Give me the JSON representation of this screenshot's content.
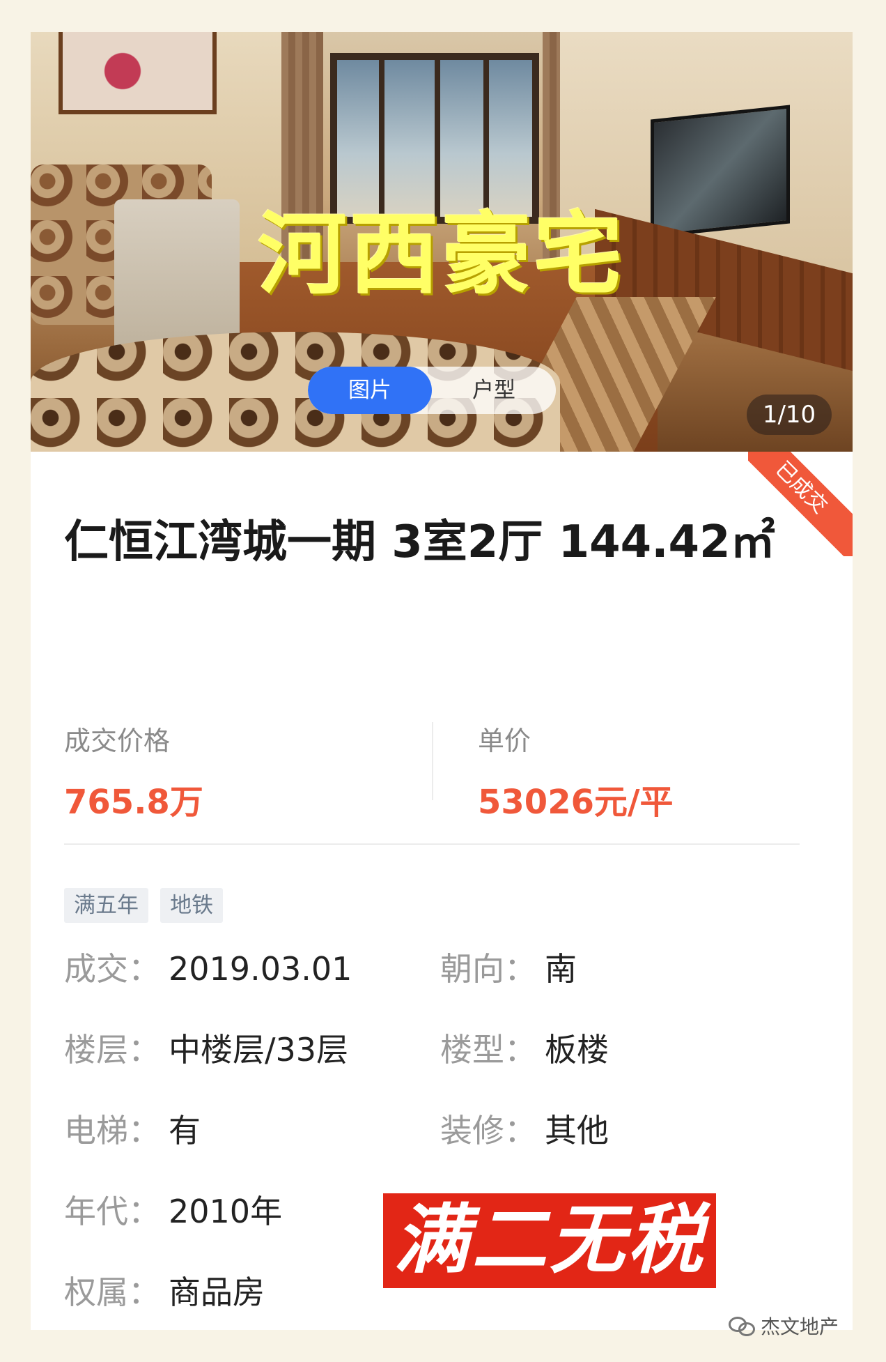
{
  "header": {
    "overlay_title": "河西豪宅",
    "tabs": [
      {
        "label": "图片",
        "active": true
      },
      {
        "label": "户型",
        "active": false
      }
    ],
    "photo_counter": "1/10"
  },
  "status_ribbon": "已成交",
  "listing": {
    "title": "仁恒江湾城一期 3室2厅 144.42㎡"
  },
  "prices": {
    "deal_label": "成交价格",
    "deal_value": "765.8万",
    "unit_label": "单价",
    "unit_value": "53026元/平"
  },
  "tags": [
    "满五年",
    "地铁"
  ],
  "details": {
    "deal_date": {
      "label": "成交：",
      "value": "2019.03.01"
    },
    "orientation": {
      "label": "朝向：",
      "value": "南"
    },
    "floor": {
      "label": "楼层：",
      "value": "中楼层/33层"
    },
    "building_type": {
      "label": "楼型：",
      "value": "板楼"
    },
    "elevator": {
      "label": "电梯：",
      "value": "有"
    },
    "decoration": {
      "label": "装修：",
      "value": "其他"
    },
    "year": {
      "label": "年代：",
      "value": "2010年"
    },
    "ownership": {
      "label": "权属：",
      "value": "商品房"
    }
  },
  "stamp_text": "满二无税",
  "watermark": {
    "icon": "wechat-icon",
    "text": "杰文地产"
  },
  "colors": {
    "accent_blue": "#3072f6",
    "price_red": "#f0583a",
    "stamp_red": "#e22616",
    "overlay_yellow": "#ffff66",
    "page_bg": "#f8f3e6"
  }
}
